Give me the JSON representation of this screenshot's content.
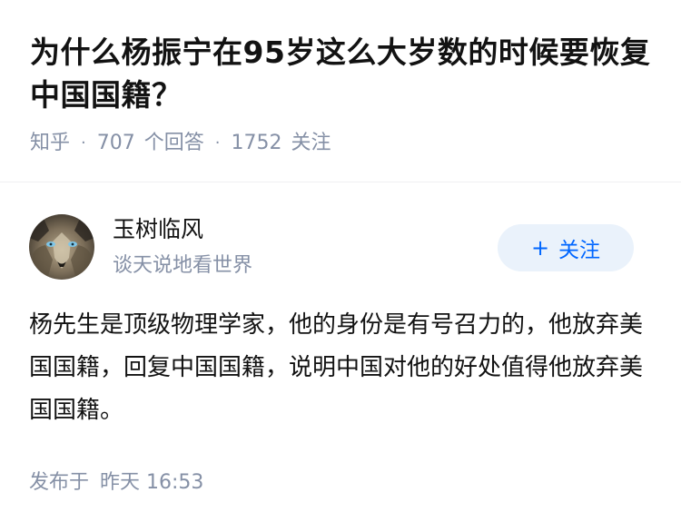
{
  "question": {
    "title": "为什么杨振宁在95岁这么大岁数的时候要恢复中国国籍？",
    "source": "知乎",
    "answer_count": "707",
    "answer_label": "个回答",
    "follower_count": "1752",
    "follower_label": "关注"
  },
  "author": {
    "name": "玉树临风",
    "bio": "谈天说地看世界",
    "avatar_icon": "wolf-avatar",
    "follow_label": "关注",
    "follow_icon": "plus-icon"
  },
  "answer": {
    "content": "杨先生是顶级物理学家，他的身份是有号召力的，他放弃美国国籍，回复中国国籍，说明中国对他的好处值得他放弃美国国籍。",
    "publish_label": "发布于",
    "publish_time": "昨天 16:53"
  },
  "colors": {
    "meta_gray": "#8590a6",
    "accent_blue": "#0066ff",
    "follow_bg": "#eaf2fb"
  }
}
